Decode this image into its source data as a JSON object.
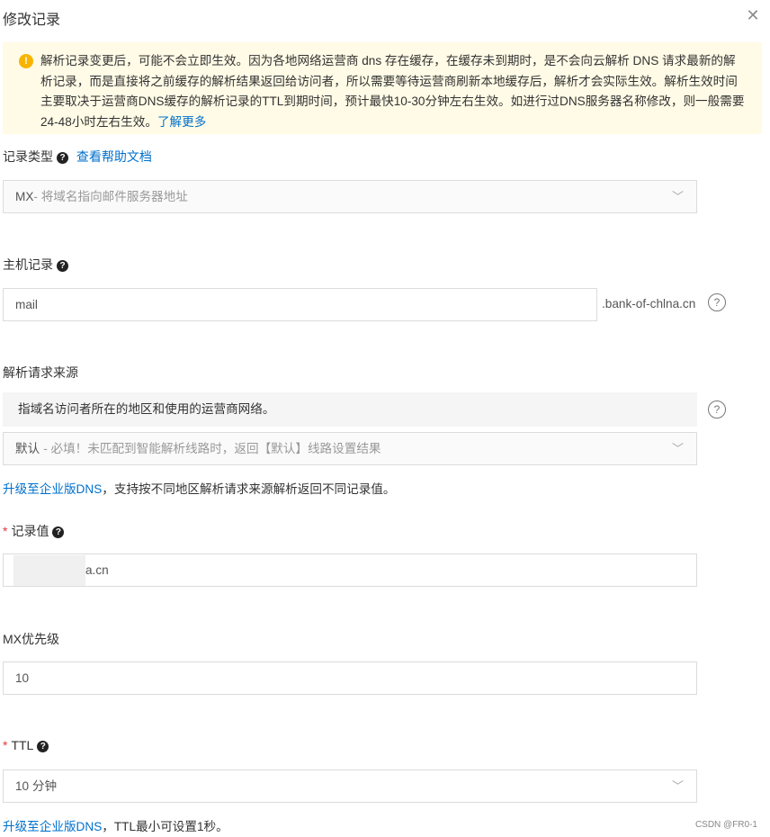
{
  "dialog": {
    "title": "修改记录",
    "close_icon": "close-icon"
  },
  "notice": {
    "icon": "warning-icon",
    "text": "解析记录变更后，可能不会立即生效。因为各地网络运营商 dns 存在缓存，在缓存未到期时，是不会向云解析 DNS 请求最新的解析记录，而是直接将之前缓存的解析结果返回给访问者，所以需要等待运营商刷新本地缓存后，解析才会实际生效。解析生效时间主要取决于运营商DNS缓存的解析记录的TTL到期时间，预计最快10-30分钟左右生效。如进行过DNS服务器名称修改，则一般需要24-48小时左右生效。",
    "link": "了解更多"
  },
  "record_type": {
    "label": "记录类型",
    "help_link": "查看帮助文档",
    "value": "MX",
    "desc": "- 将域名指向邮件服务器地址"
  },
  "host_record": {
    "label": "主机记录",
    "value": "mail",
    "suffix": ".bank-of-chlna.cn"
  },
  "resolve_source": {
    "label": "解析请求来源",
    "info": "指域名访问者所在的地区和使用的运营商网络。",
    "value": "默认",
    "desc": "- 必填！未匹配到智能解析线路时，返回【默认】线路设置结果",
    "upgrade_link": "升级至企业版DNS",
    "upgrade_text": "，支持按不同地区解析请求来源解析返回不同记录值。"
  },
  "record_value": {
    "label": "记录值",
    "required_mark": "*",
    "value": "a.cn"
  },
  "mx_priority": {
    "label": "MX优先级",
    "value": "10"
  },
  "ttl": {
    "label": "TTL",
    "required_mark": "*",
    "value": "10 分钟",
    "upgrade_link": "升级至企业版DNS",
    "upgrade_text": "，TTL最小可设置1秒。"
  },
  "watermark": "CSDN @FR0-1"
}
